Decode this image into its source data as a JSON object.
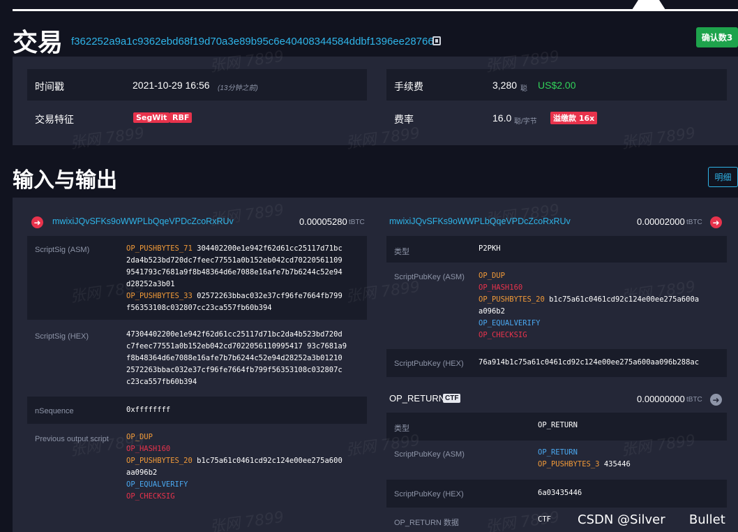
{
  "header": {
    "title": "交易",
    "txid": "f362252a9a1c9362ebd68f19d70a3e89b95c6e40408344584ddbf1396ee28766",
    "confirm_label": "确认数3"
  },
  "details": {
    "timestamp_label": "时间戳",
    "timestamp_value": "2021-10-29 16:56",
    "timestamp_relative": "(13分钟之前)",
    "features_label": "交易特征",
    "feature_badges": [
      "SegWit",
      "RBF"
    ],
    "fee_label": "手续费",
    "fee_value": "3,280",
    "fee_unit": "聪",
    "fee_usd": "US$2.00",
    "rate_label": "费率",
    "rate_value": "16.0",
    "rate_unit": "聪/字节",
    "overpay_badge": "溢缴款 16x"
  },
  "io": {
    "title": "输入与输出",
    "detail_button": "明细"
  },
  "input": {
    "address": "mwixiJQvSFKs9oWWPLbQqeVPDcZcoRxRUv",
    "amount": "0.00005280",
    "unit": "tBTC",
    "scriptsig_asm_label": "ScriptSig (ASM)",
    "asm_op1": "OP_PUSHBYTES_71",
    "asm_data1_first": " 304402200e1e942f62d61cc25117d71bc",
    "asm_data1_rest": "2da4b523bd720dc7feec77551a0b152eb042cd70220561109\n9541793c7681a9f8b48364d6e7088e16afe7b7b6244c52e94\nd28252a3b01",
    "asm_op2": "OP_PUSHBYTES_33",
    "asm_data2_first": " 02572263bbac032e37cf96fe7664fb799",
    "asm_data2_rest": "f56353108c032807cc23ca557fb60b394",
    "scriptsig_hex_label": "ScriptSig (HEX)",
    "scriptsig_hex": "47304402200e1e942f62d61cc25117d71bc2da4b523bd720d\nc7feec77551a0b152eb042cd7022056110995417 93c7681a9\nf8b48364d6e7088e16afe7b7b6244c52e94d28252a3b01210\n2572263bbac032e37cf96fe7664fb799f56353108c032807c\nc23ca557fb60b394",
    "nsequence_label": "nSequence",
    "nsequence_value": "0xffffffff",
    "prev_script_label": "Previous output script",
    "prev_op_dup": "OP_DUP",
    "prev_op_hash160": "OP_HASH160",
    "prev_op_push20": "OP_PUSHBYTES_20",
    "prev_push20_first": " b1c75a61c0461cd92c124e00ee275a600",
    "prev_push20_rest": "aa096b2",
    "prev_op_equalverify": "OP_EQUALVERIFY",
    "prev_op_checksig": "OP_CHECKSIG"
  },
  "output1": {
    "address": "mwixiJQvSFKs9oWWPLbQqeVPDcZcoRxRUv",
    "amount": "0.00002000",
    "unit": "tBTC",
    "type_label": "类型",
    "type_value": "P2PKH",
    "spk_asm_label": "ScriptPubKey (ASM)",
    "op_dup": "OP_DUP",
    "op_hash160": "OP_HASH160",
    "op_push20": "OP_PUSHBYTES_20",
    "push20_first": " b1c75a61c0461cd92c124e00ee275a600a",
    "push20_rest": "a096b2",
    "op_equalverify": "OP_EQUALVERIFY",
    "op_checksig": "OP_CHECKSIG",
    "spk_hex_label": "ScriptPubKey (HEX)",
    "spk_hex": "76a914b1c75a61c0461cd92c124e00ee275a600aa096b288ac"
  },
  "output2": {
    "title": "OP_RETURN",
    "ctf_badge": "CTF",
    "amount": "0.00000000",
    "unit": "tBTC",
    "type_label": "类型",
    "type_value": "OP_RETURN",
    "spk_asm_label": "ScriptPubKey (ASM)",
    "asm_op_return": "OP_RETURN",
    "asm_op_push3": "OP_PUSHBYTES_3",
    "asm_push3_data": " 435446",
    "spk_hex_label": "ScriptPubKey (HEX)",
    "spk_hex": "6a03435446",
    "data_label": "OP_RETURN 数据",
    "data_value": "CTF"
  },
  "watermark": "张网 7899",
  "footer_watermark": "CSDN @Silver      Bullet",
  "colors": {
    "background": "#11131f",
    "panel": "#242737",
    "link": "#2fb4e8",
    "red": "#e8334c",
    "green": "#1ea34c",
    "orange": "#f19a38"
  }
}
